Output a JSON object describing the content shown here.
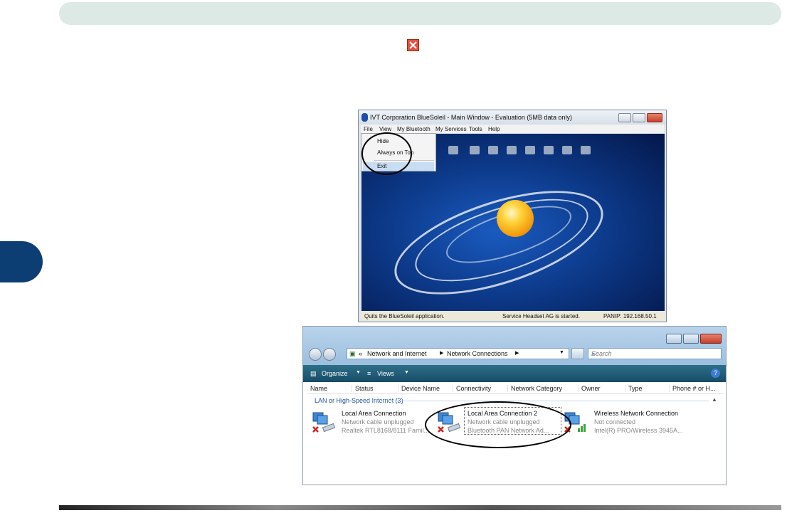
{
  "page": {
    "close_icon": "close-icon"
  },
  "bluesoleil": {
    "title": "IVT Corporation BlueSoleil - Main Window - Evaluation (5MB data only)",
    "menu": [
      "File",
      "View",
      "My Bluetooth",
      "My Services",
      "Tools",
      "Help"
    ],
    "file_menu": [
      "Hide",
      "Always on Top",
      "Exit"
    ],
    "status": {
      "left": "Quits the BlueSoleil application.",
      "middle": "Service Headset AG is started.",
      "right": "PANIP: 192.168.50.1"
    }
  },
  "network": {
    "breadcrumb": [
      "«",
      "Network and Internet",
      "Network Connections"
    ],
    "search_placeholder": "Search",
    "toolbar": {
      "organize": "Organize",
      "views": "Views",
      "help": "?"
    },
    "columns": [
      "Name",
      "Status",
      "Device Name",
      "Connectivity",
      "Network Category",
      "Owner",
      "Type",
      "Phone # or H..."
    ],
    "group": "LAN or High-Speed Internet (3)",
    "connections": [
      {
        "name": "Local Area Connection",
        "status": "Network cable unplugged",
        "device": "Realtek RTL8168/8111 Famil..."
      },
      {
        "name": "Local Area Connection 2",
        "status": "Network cable unplugged",
        "device": "Bluetooth PAN Network Ad..."
      },
      {
        "name": "Wireless Network Connection",
        "status": "Not connected",
        "device": "Intel(R) PRO/Wireless 3945A..."
      }
    ]
  }
}
